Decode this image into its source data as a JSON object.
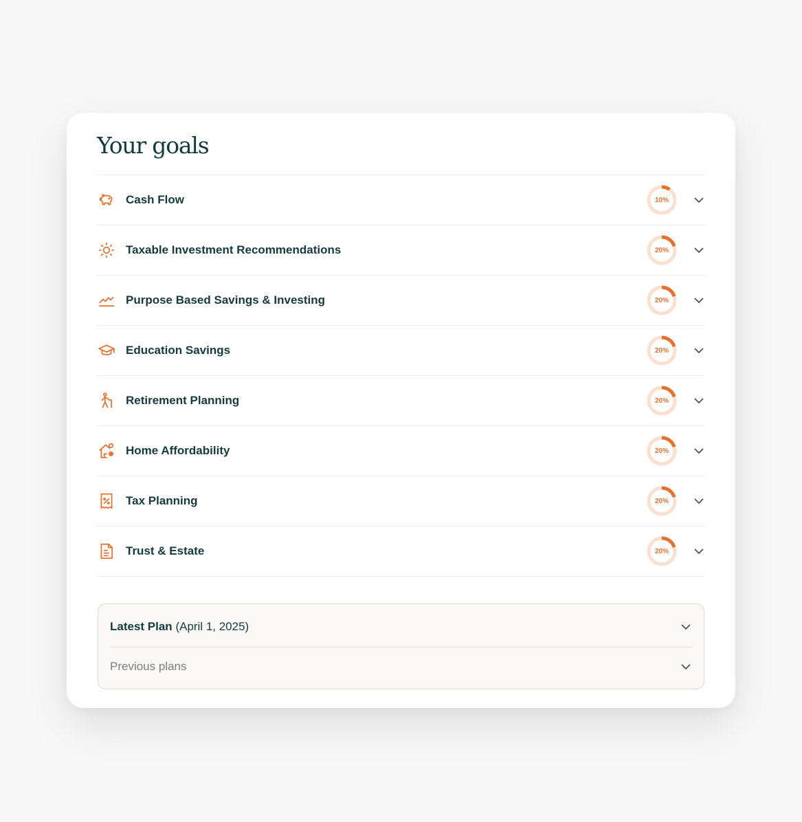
{
  "title": "Your goals",
  "colors": {
    "accent": "#e8702d",
    "ring_track": "#fbe0d0",
    "text": "#143a40"
  },
  "goals": [
    {
      "label": "Cash Flow",
      "icon": "piggy-bank-icon",
      "progress": 10,
      "progress_label": "10%"
    },
    {
      "label": "Taxable Investment Recommendations",
      "icon": "sun-icon",
      "progress": 20,
      "progress_label": "20%"
    },
    {
      "label": "Purpose Based Savings & Investing",
      "icon": "trend-line-icon",
      "progress": 20,
      "progress_label": "20%"
    },
    {
      "label": "Education Savings",
      "icon": "graduation-cap-icon",
      "progress": 20,
      "progress_label": "20%"
    },
    {
      "label": "Retirement Planning",
      "icon": "elder-person-icon",
      "progress": 20,
      "progress_label": "20%"
    },
    {
      "label": "Home Affordability",
      "icon": "home-sparkle-icon",
      "progress": 20,
      "progress_label": "20%"
    },
    {
      "label": "Tax Planning",
      "icon": "tax-receipt-icon",
      "progress": 20,
      "progress_label": "20%"
    },
    {
      "label": "Trust & Estate",
      "icon": "document-icon",
      "progress": 20,
      "progress_label": "20%"
    }
  ],
  "plans": {
    "latest_label": "Latest Plan",
    "latest_date": "(April 1, 2025)",
    "previous_label": "Previous plans"
  }
}
